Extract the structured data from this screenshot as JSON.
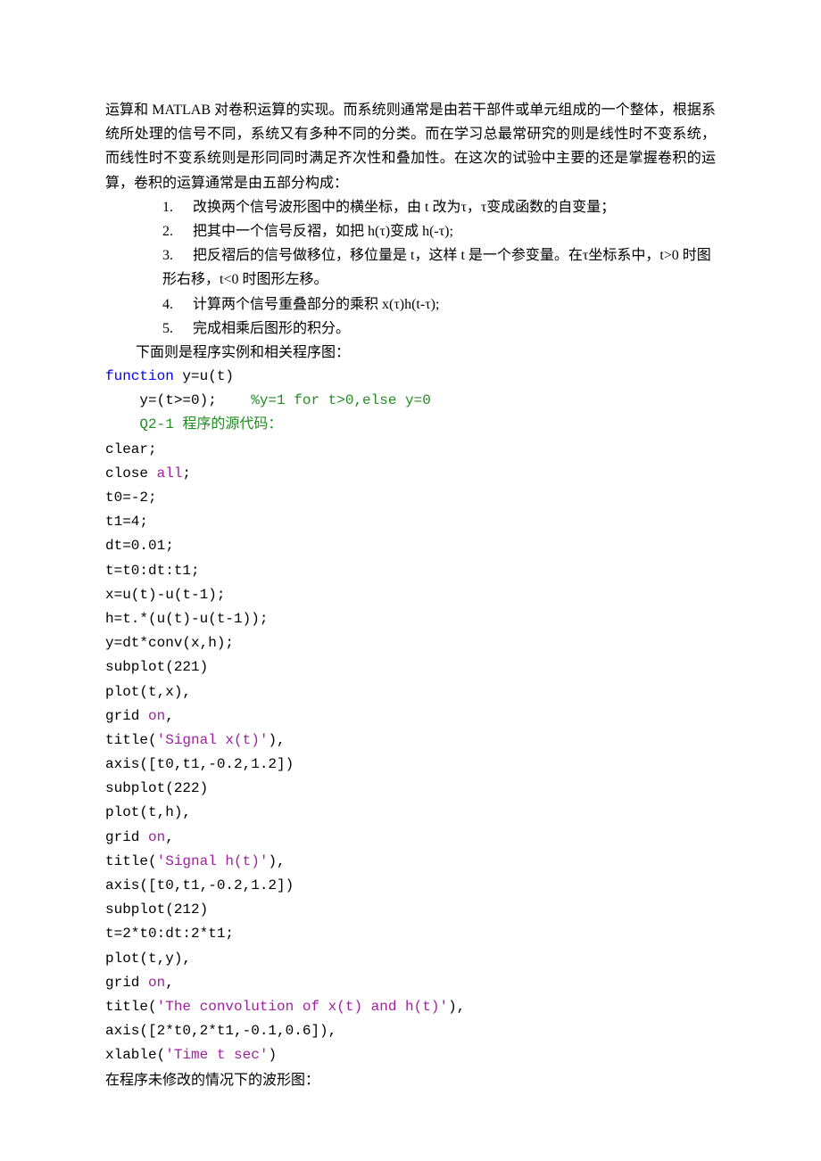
{
  "intro": "运算和 MATLAB 对卷积运算的实现。而系统则通常是由若干部件或单元组成的一个整体，根据系统所处理的信号不同，系统又有多种不同的分类。而在学习总最常研究的则是线性时不变系统，而线性时不变系统则是形同同时满足齐次性和叠加性。在这次的试验中主要的还是掌握卷积的运算，卷积的运算通常是由五部分构成：",
  "list": {
    "n1": "1.",
    "t1": "改换两个信号波形图中的横坐标，由 t 改为τ，τ变成函数的自变量；",
    "n2": "2.",
    "t2": "把其中一个信号反褶，如把 h(τ)变成 h(-τ);",
    "n3": "3.",
    "t3": "把反褶后的信号做移位，移位量是 t，这样 t 是一个参变量。在τ坐标系中，t>0 时图形右移，t<0 时图形左移。",
    "n4": "4.",
    "t4": "计算两个信号重叠部分的乘积 x(τ)h(t-τ);",
    "n5": "5.",
    "t5": "完成相乘后图形的积分。"
  },
  "after_list": "下面则是程序实例和相关程序图：",
  "code": {
    "l01a": "function",
    "l01b": " y=u(t)",
    "l02a": "    y=(t>=0);   ",
    "l02b": " %y=1 for t>0,else y=0",
    "l03": "    Q2-1 程序的源代码：",
    "l04": "clear;",
    "l05a": "close ",
    "l05b": "all",
    "l05c": ";",
    "l06": "t0=-2;",
    "l07": "t1=4;",
    "l08": "dt=0.01;",
    "l09": "t=t0:dt:t1;",
    "l10": "x=u(t)-u(t-1);",
    "l11": "h=t.*(u(t)-u(t-1));",
    "l12": "y=dt*conv(x,h);",
    "l13": "subplot(221)",
    "l14": "plot(t,x),",
    "l15a": "grid ",
    "l15b": "on",
    "l15c": ",",
    "l16a": "title(",
    "l16b": "'Signal x(t)'",
    "l16c": "),",
    "l17": "axis([t0,t1,-0.2,1.2])",
    "l18": "subplot(222)",
    "l19": "plot(t,h),",
    "l20a": "grid ",
    "l20b": "on",
    "l20c": ",",
    "l21a": "title(",
    "l21b": "'Signal h(t)'",
    "l21c": "),",
    "l22": "axis([t0,t1,-0.2,1.2])",
    "l23": "subplot(212)",
    "l24": "t=2*t0:dt:2*t1;",
    "l25": "plot(t,y),",
    "l26a": "grid ",
    "l26b": "on",
    "l26c": ",",
    "l27a": "title(",
    "l27b": "'The convolution of x(t) and h(t)'",
    "l27c": "),",
    "l28": "axis([2*t0,2*t1,-0.1,0.6]),",
    "l29a": "xlable(",
    "l29b": "'Time t sec'",
    "l29c": ")"
  },
  "footer": "    在程序未修改的情况下的波形图："
}
